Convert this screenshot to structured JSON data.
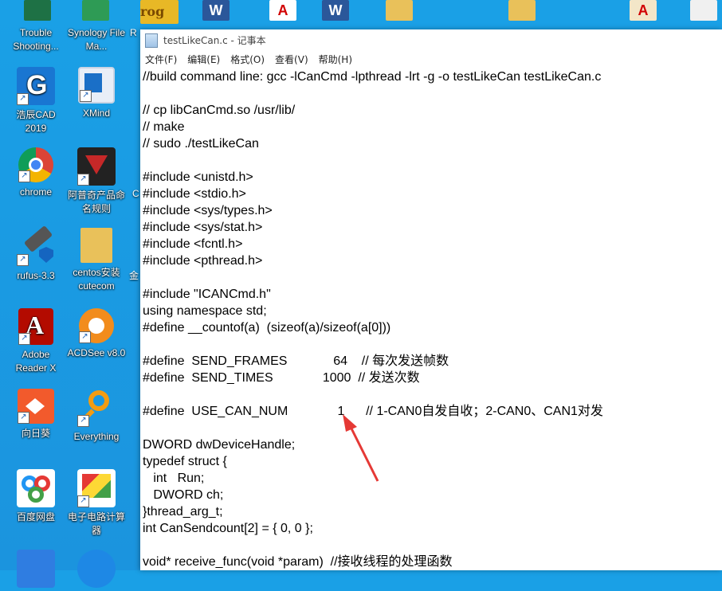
{
  "window": {
    "title": "testLikeCan.c - 记事本",
    "menu": [
      "文件(F)",
      "编辑(E)",
      "格式(O)",
      "查看(V)",
      "帮助(H)"
    ]
  },
  "top_icons": {
    "frog_text": "rog",
    "word_letter": "W",
    "pdf_letter": "A"
  },
  "desktop_icons": [
    {
      "label": "Trouble Shooting...",
      "icon": "excel-icon",
      "color": "#1e7145"
    },
    {
      "label": "Synology File Ma...",
      "icon": "synology-icon",
      "color": "#2e9b55"
    },
    {
      "label": "浩辰CAD 2019",
      "icon": "gstarcad-icon",
      "color": "#1976d2"
    },
    {
      "label": "XMind",
      "icon": "xmind-icon",
      "color": "#e8eef7"
    },
    {
      "label": "chrome",
      "icon": "chrome-icon",
      "color": "#ffffff"
    },
    {
      "label": "阿普奇产品命名规则",
      "icon": "superman-icon",
      "color": "#222222"
    },
    {
      "label": "rufus-3.3",
      "icon": "usb-drive-icon",
      "color": "#6b6b6b"
    },
    {
      "label": "centos安装cutecom",
      "icon": "folder-icon",
      "color": "#e9c15a"
    },
    {
      "label": "Adobe Reader X",
      "icon": "adobe-reader-icon",
      "color": "#b30b00"
    },
    {
      "label": "ACDSee v8.0",
      "icon": "acdsee-icon",
      "color": "#f28c1c"
    },
    {
      "label": "向日葵",
      "icon": "sunflower-icon",
      "color": "#f25a2c"
    },
    {
      "label": "Everything",
      "icon": "search-magnifier-icon",
      "color": "#f39c12"
    },
    {
      "label": "百度网盘",
      "icon": "baidu-netdisk-icon",
      "color": "#ffffff"
    },
    {
      "label": "电子电路计算器",
      "icon": "calculator-icon",
      "color": "#ffffff"
    },
    {
      "label": "",
      "icon": "bird-icon",
      "color": "#2f7de1"
    },
    {
      "label": "",
      "icon": "thunder-icon",
      "color": "#1e88e5"
    }
  ],
  "side_labels": {
    "r1": "R",
    "r2": "C",
    "r3": "金"
  },
  "code_lines": [
    "//build command line: gcc -lCanCmd -lpthread -lrt -g -o testLikeCan testLikeCan.c",
    "",
    "// cp libCanCmd.so /usr/lib/",
    "// make",
    "// sudo ./testLikeCan",
    "",
    "#include <unistd.h>",
    "#include <stdio.h>",
    "#include <sys/types.h>",
    "#include <sys/stat.h>",
    "#include <fcntl.h>",
    "#include <pthread.h>",
    "",
    "#include \"ICANCmd.h\"",
    "using namespace std;",
    "#define __countof(a)  (sizeof(a)/sizeof(a[0]))",
    "",
    "#define  SEND_FRAMES             64    // 每次发送帧数",
    "#define  SEND_TIMES              1000  // 发送次数",
    "",
    "#define  USE_CAN_NUM              1      // 1-CAN0自发自收；2-CAN0、CAN1对发",
    "",
    "DWORD dwDeviceHandle;",
    "typedef struct {",
    "   int   Run;",
    "   DWORD ch;",
    "}thread_arg_t;",
    "int CanSendcount[2] = { 0, 0 };",
    "",
    "void* receive_func(void *param)  //接收线程的处理函数"
  ],
  "colors": {
    "annotation_arrow": "#e53935"
  }
}
